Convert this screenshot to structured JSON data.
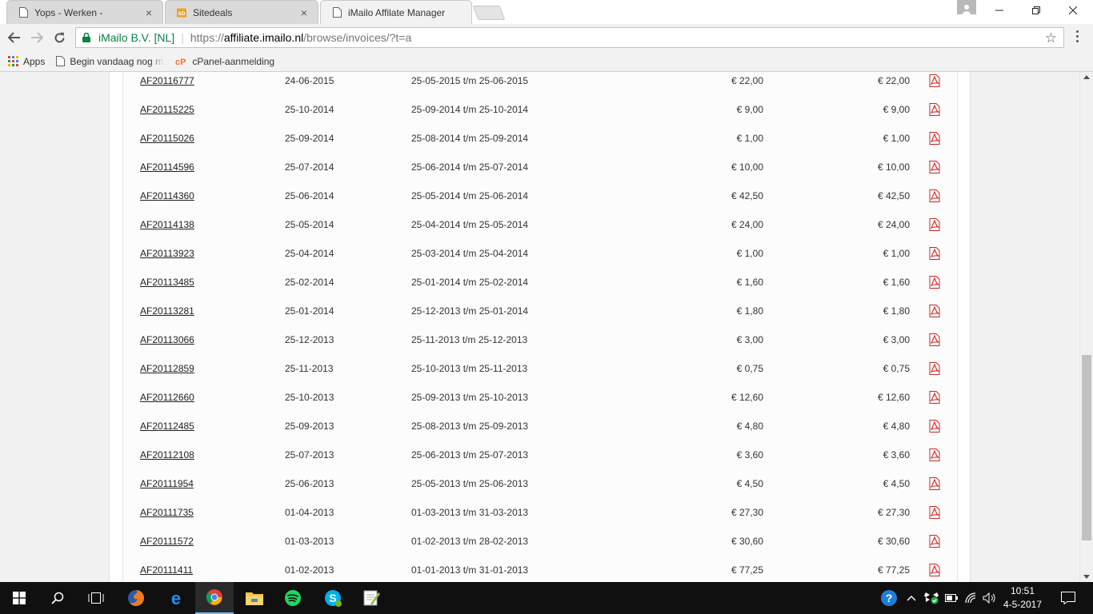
{
  "browser": {
    "tabs": [
      {
        "title": "Yops - Werken -",
        "active": false
      },
      {
        "title": "Sitedeals",
        "active": false
      },
      {
        "title": "iMailo Affilate Manager",
        "active": true
      }
    ],
    "site_name": "iMailo B.V. [NL]",
    "url_scheme": "https://",
    "url_host": "affiliate.imailo.nl",
    "url_path": "/browse/invoices/?t=a",
    "bookmarks": [
      "Apps",
      "Begin vandaag nog m",
      "cPanel-aanmelding"
    ]
  },
  "invoices": [
    {
      "number": "AF20116777",
      "date": "24-06-2015",
      "period": "25-05-2015 t/m 25-06-2015",
      "amount": "€ 22,00",
      "total": "€ 22,00"
    },
    {
      "number": "AF20115225",
      "date": "25-10-2014",
      "period": "25-09-2014 t/m 25-10-2014",
      "amount": "€ 9,00",
      "total": "€ 9,00"
    },
    {
      "number": "AF20115026",
      "date": "25-09-2014",
      "period": "25-08-2014 t/m 25-09-2014",
      "amount": "€ 1,00",
      "total": "€ 1,00"
    },
    {
      "number": "AF20114596",
      "date": "25-07-2014",
      "period": "25-06-2014 t/m 25-07-2014",
      "amount": "€ 10,00",
      "total": "€ 10,00"
    },
    {
      "number": "AF20114360",
      "date": "25-06-2014",
      "period": "25-05-2014 t/m 25-06-2014",
      "amount": "€ 42,50",
      "total": "€ 42,50"
    },
    {
      "number": "AF20114138",
      "date": "25-05-2014",
      "period": "25-04-2014 t/m 25-05-2014",
      "amount": "€ 24,00",
      "total": "€ 24,00"
    },
    {
      "number": "AF20113923",
      "date": "25-04-2014",
      "period": "25-03-2014 t/m 25-04-2014",
      "amount": "€ 1,00",
      "total": "€ 1,00"
    },
    {
      "number": "AF20113485",
      "date": "25-02-2014",
      "period": "25-01-2014 t/m 25-02-2014",
      "amount": "€ 1,60",
      "total": "€ 1,60"
    },
    {
      "number": "AF20113281",
      "date": "25-01-2014",
      "period": "25-12-2013 t/m 25-01-2014",
      "amount": "€ 1,80",
      "total": "€ 1,80"
    },
    {
      "number": "AF20113066",
      "date": "25-12-2013",
      "period": "25-11-2013 t/m 25-12-2013",
      "amount": "€ 3,00",
      "total": "€ 3,00"
    },
    {
      "number": "AF20112859",
      "date": "25-11-2013",
      "period": "25-10-2013 t/m 25-11-2013",
      "amount": "€ 0,75",
      "total": "€ 0,75"
    },
    {
      "number": "AF20112660",
      "date": "25-10-2013",
      "period": "25-09-2013 t/m 25-10-2013",
      "amount": "€ 12,60",
      "total": "€ 12,60"
    },
    {
      "number": "AF20112485",
      "date": "25-09-2013",
      "period": "25-08-2013 t/m 25-09-2013",
      "amount": "€ 4,80",
      "total": "€ 4,80"
    },
    {
      "number": "AF20112108",
      "date": "25-07-2013",
      "period": "25-06-2013 t/m 25-07-2013",
      "amount": "€ 3,60",
      "total": "€ 3,60"
    },
    {
      "number": "AF20111954",
      "date": "25-06-2013",
      "period": "25-05-2013 t/m 25-06-2013",
      "amount": "€ 4,50",
      "total": "€ 4,50"
    },
    {
      "number": "AF20111735",
      "date": "01-04-2013",
      "period": "01-03-2013 t/m 31-03-2013",
      "amount": "€ 27,30",
      "total": "€ 27,30"
    },
    {
      "number": "AF20111572",
      "date": "01-03-2013",
      "period": "01-02-2013 t/m 28-02-2013",
      "amount": "€ 30,60",
      "total": "€ 30,60"
    },
    {
      "number": "AF20111411",
      "date": "01-02-2013",
      "period": "01-01-2013 t/m 31-01-2013",
      "amount": "€ 77,25",
      "total": "€ 77,25"
    }
  ],
  "taskbar": {
    "apps": [
      "windows-start",
      "search",
      "task-view",
      "firefox",
      "edge",
      "chrome",
      "file-explorer",
      "spotify",
      "skype",
      "notepad-plus-plus"
    ],
    "clock_time": "10:51",
    "clock_date": "4-5-2017"
  },
  "colors": {
    "accent": "#0b8043",
    "pdf_red": "#d32f2f",
    "taskbar": "#101010"
  }
}
